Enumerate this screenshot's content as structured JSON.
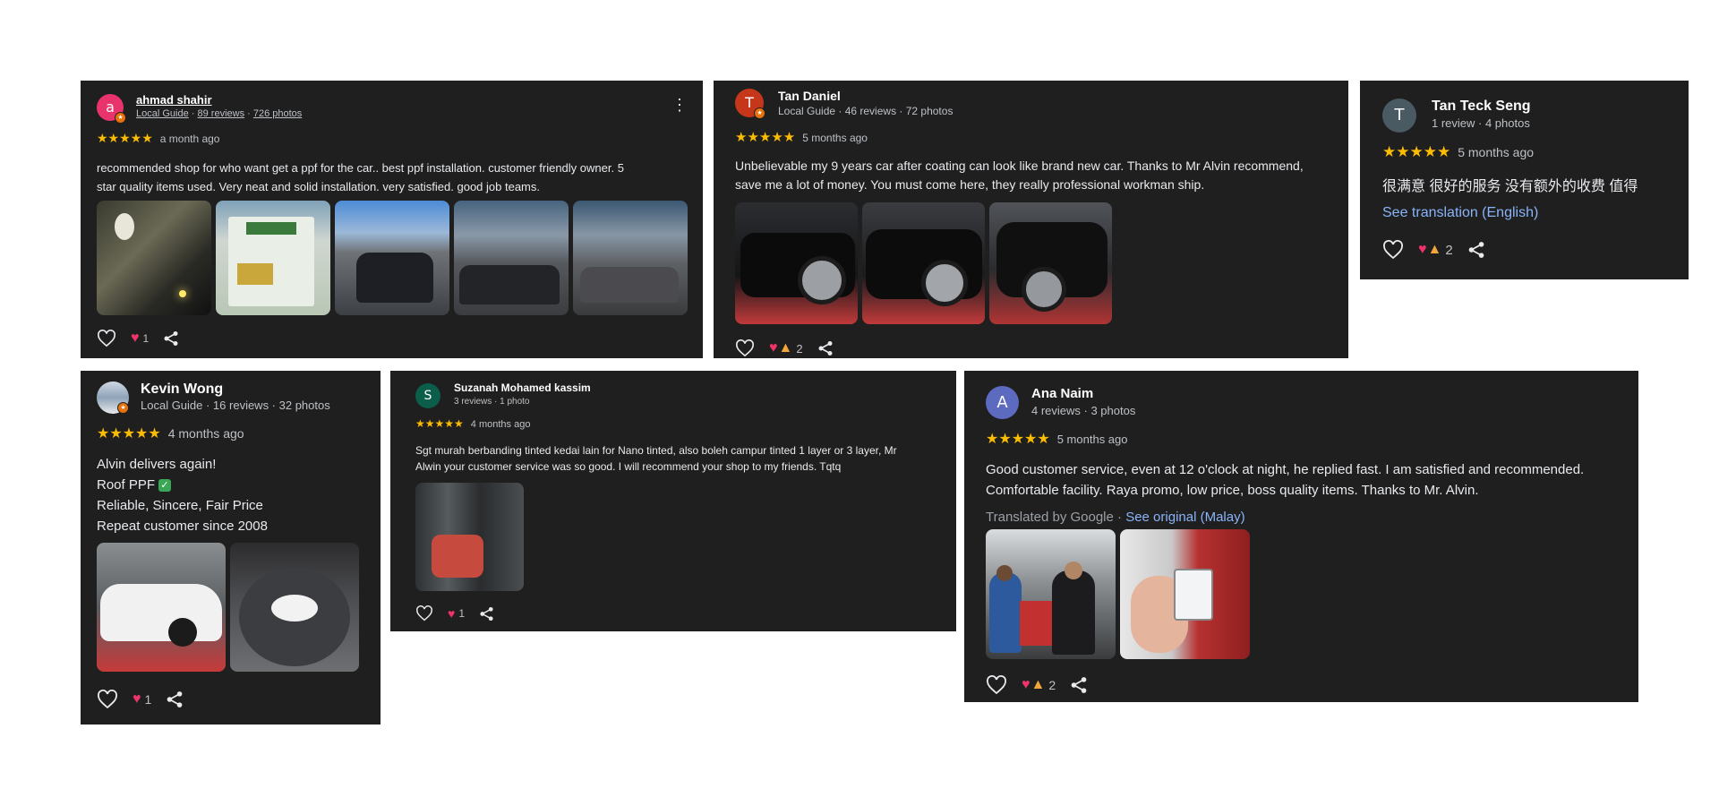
{
  "colors": {
    "card_bg": "#1f1f1f",
    "star": "#fbbc04",
    "link": "#8ab4f8",
    "heart": "#f0336b"
  },
  "reviews": [
    {
      "id": "ahmad",
      "avatar_letter": "a",
      "avatar_color": "#e8336d",
      "name": "ahmad shahir",
      "meta_role": "Local Guide",
      "meta_reviews": "89 reviews",
      "meta_photos": "726 photos",
      "stars": "★★★★★",
      "ago": "a month ago",
      "text_lines": [
        "recommended shop for who want get a ppf for the car.. best ppf installation. customer friendly owner. 5",
        "star quality items used. Very neat and solid installation. very satisfied. good job teams."
      ],
      "likes": "1",
      "more_icon": "more-vert-icon"
    },
    {
      "id": "tan-daniel",
      "avatar_letter": "T",
      "avatar_color": "#c5361a",
      "name": "Tan Daniel",
      "meta": "Local Guide · 46 reviews · 72 photos",
      "stars": "★★★★★",
      "ago": "5 months ago",
      "text_lines": [
        "Unbelievable my 9 years car after coating can look like brand new car. Thanks to Mr Alvin recommend,",
        "save me a lot of money. You must come here, they really professional workman ship."
      ],
      "likes": "2"
    },
    {
      "id": "tan-teck-seng",
      "avatar_letter": "T",
      "avatar_color": "#4a5a63",
      "name": "Tan Teck Seng",
      "meta": "1 review · 4 photos",
      "stars": "★★★★★",
      "ago": "5 months ago",
      "text": "很满意 很好的服务 没有额外的收费 值得",
      "translate_link": "See translation (English)",
      "likes": "2"
    },
    {
      "id": "kevin-wong",
      "name": "Kevin Wong",
      "meta": "Local Guide · 16 reviews · 32 photos",
      "stars": "★★★★★",
      "ago": "4 months ago",
      "text_lines": [
        "Alvin delivers again!",
        "Roof PPF",
        "Reliable, Sincere, Fair Price",
        "Repeat customer since 2008"
      ],
      "check": "✓",
      "likes": "1"
    },
    {
      "id": "suzanah",
      "avatar_letter": "S",
      "avatar_color": "#0b5e4a",
      "name": "Suzanah Mohamed kassim",
      "meta": "3 reviews · 1 photo",
      "stars": "★★★★★",
      "ago": "4 months ago",
      "text_lines": [
        "Sgt murah berbanding tinted kedai lain for Nano tinted, also boleh campur tinted 1 layer or 3 layer, Mr",
        "Alwin your customer service was so good. I will recommend your shop to my friends. Tqtq"
      ],
      "likes": "1"
    },
    {
      "id": "ana-naim",
      "avatar_letter": "A",
      "avatar_color": "#5c6bc0",
      "name": "Ana Naim",
      "meta": "4 reviews · 3 photos",
      "stars": "★★★★★",
      "ago": "5 months ago",
      "text_lines": [
        "Good customer service, even at 12 o'clock at night, he replied fast. I am satisfied and recommended.",
        "Comfortable facility. Raya promo, low price, boss quality items. Thanks to Mr. Alvin."
      ],
      "translated_by": "Translated by Google · ",
      "see_original": "See original (Malay)",
      "likes": "2"
    }
  ]
}
